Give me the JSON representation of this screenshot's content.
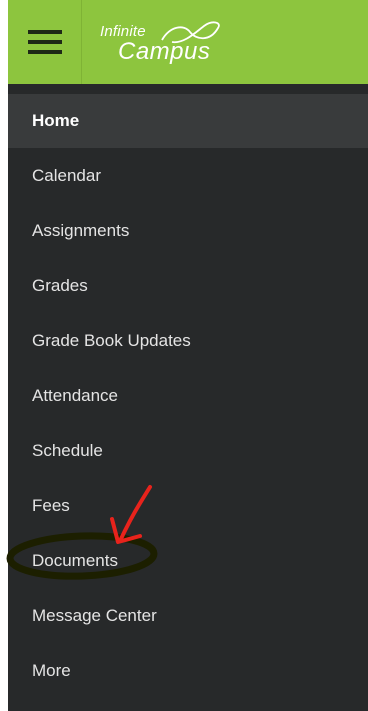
{
  "header": {
    "menu_icon": "hamburger-menu-icon",
    "logo_top": "Infinite",
    "logo_bottom": "Campus",
    "brand_color": "#8dc53e"
  },
  "sidebar": {
    "background": "#27292a",
    "active_background": "#393b3c",
    "items": [
      {
        "label": "Home",
        "active": true
      },
      {
        "label": "Calendar"
      },
      {
        "label": "Assignments"
      },
      {
        "label": "Grades"
      },
      {
        "label": "Grade Book Updates"
      },
      {
        "label": "Attendance"
      },
      {
        "label": "Schedule"
      },
      {
        "label": "Fees"
      },
      {
        "label": "Documents"
      },
      {
        "label": "Message Center"
      },
      {
        "label": "More"
      }
    ]
  },
  "annotation": {
    "arrow_color": "#e8231c",
    "circle_color": "#1c1f00",
    "target": "Documents"
  }
}
